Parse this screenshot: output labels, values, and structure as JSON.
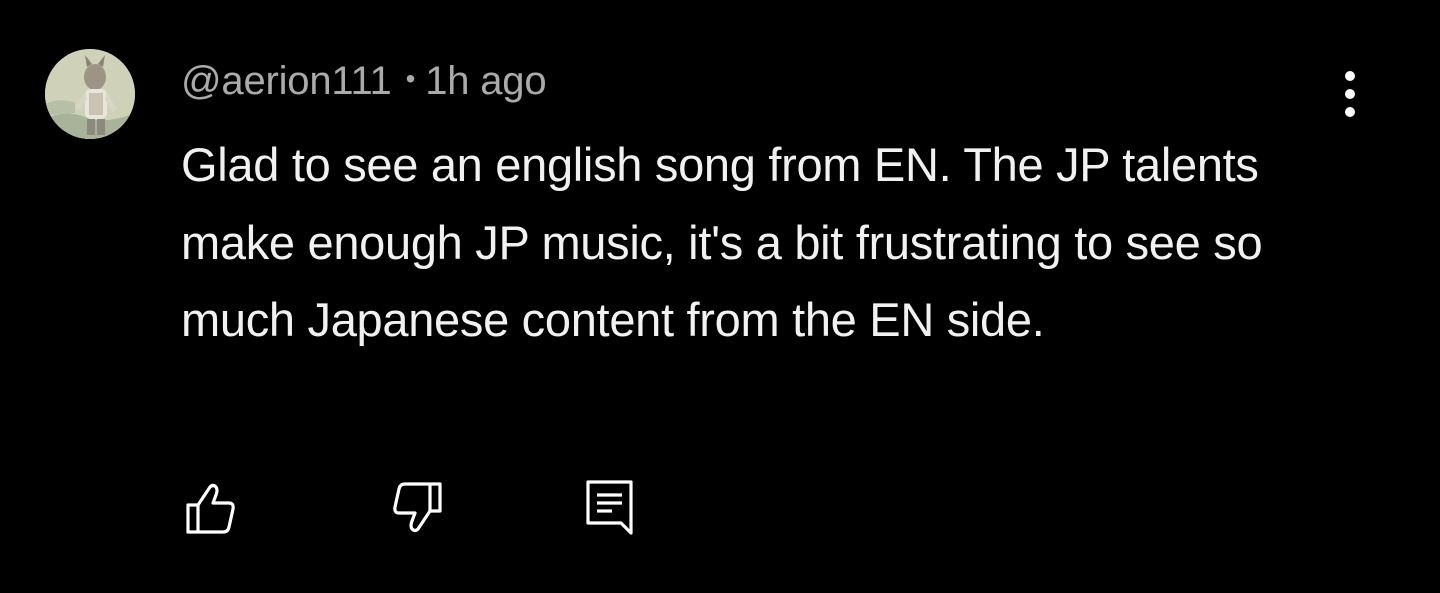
{
  "comment": {
    "author": "@aerion111",
    "separator": "•",
    "timestamp": "1h ago",
    "text": "Glad to see an english song from EN. The JP talents make enough JP music, it's a bit frustrating to see so much Japanese content from the EN side.",
    "avatar_icon": "user-avatar-illustration"
  },
  "actions": {
    "like_icon": "thumbs-up-icon",
    "dislike_icon": "thumbs-down-icon",
    "reply_icon": "reply-comment-icon",
    "menu_icon": "more-vertical-icon"
  },
  "colors": {
    "background": "#000000",
    "text_primary": "#f1f1f1",
    "text_secondary": "#aaaaaa"
  }
}
